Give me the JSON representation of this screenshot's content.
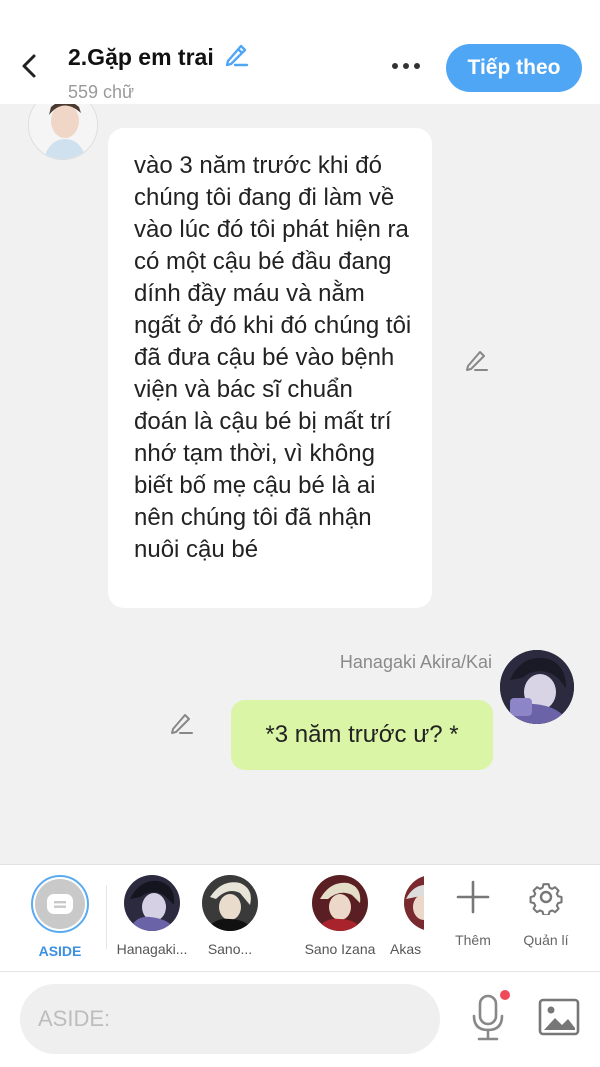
{
  "header": {
    "title": "2.Gặp em trai",
    "word_count": "559 chữ",
    "next_label": "Tiếp theo"
  },
  "messages": [
    {
      "side": "left",
      "text": "vào 3 năm trước khi đó chúng tôi đang đi làm về vào lúc đó tôi phát hiện ra có một cậu bé đầu đang dính đầy máu và nằm ngất ở đó khi đó chúng tôi đã đưa cậu bé vào bệnh viện và bác sĩ chuẩn đoán là cậu bé bị mất trí nhớ tạm thời, vì không biết bố mẹ cậu bé là ai nên chúng tôi đã nhận nuôi cậu bé"
    },
    {
      "side": "right",
      "sender": "Hanagaki Akira/Kai",
      "text": "*3 năm trước ư? *"
    }
  ],
  "characters": {
    "aside_label": "ASIDE",
    "items": [
      {
        "label": "Hanagaki..."
      },
      {
        "label": "Sano..."
      },
      {
        "label": "Sano Izana"
      },
      {
        "label": "Akas"
      }
    ],
    "add_label": "Thêm",
    "manage_label": "Quản lí"
  },
  "input": {
    "placeholder": "ASIDE:"
  },
  "colors": {
    "accent": "#4fa6f5",
    "right_bubble": "#d9f5a5",
    "left_bubble": "#ffffff",
    "background": "#f1f1f1",
    "mic_dot": "#f04a5a"
  }
}
